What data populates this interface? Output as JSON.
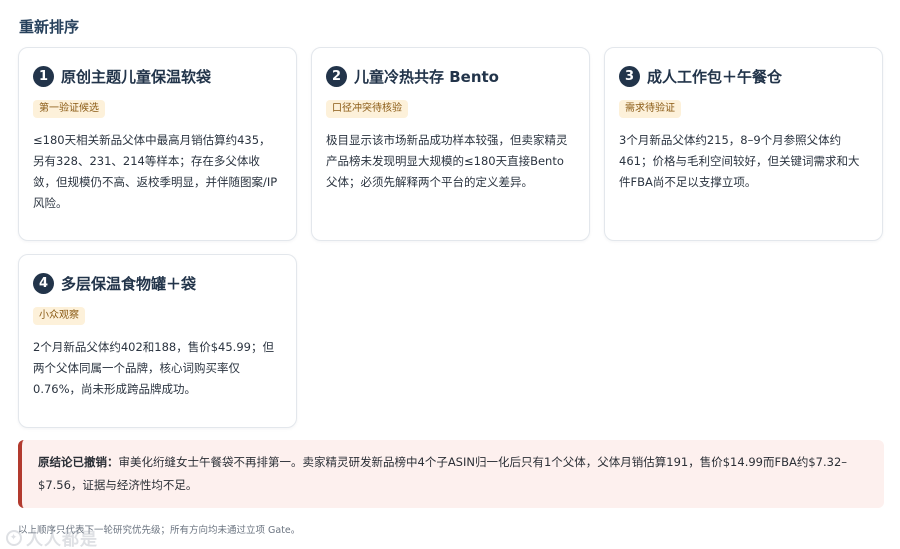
{
  "page": {
    "title": "重新排序"
  },
  "cards": [
    {
      "number": "1",
      "title": "原创主题儿童保温软袋",
      "tag": "第一验证候选",
      "body": "≤180天相关新品父体中最高月销估算约435，另有328、231、214等样本；存在多父体收敛，但规模仍不高、返校季明显，并伴随图案/IP风险。"
    },
    {
      "number": "2",
      "title": "儿童冷热共存 Bento",
      "tag": "口径冲突待核验",
      "body": "极目显示该市场新品成功样本较强，但卖家精灵产品榜未发现明显大规模的≤180天直接Bento父体；必须先解释两个平台的定义差异。"
    },
    {
      "number": "3",
      "title": "成人工作包＋午餐仓",
      "tag": "需求待验证",
      "body": "3个月新品父体约215，8–9个月参照父体约461；价格与毛利空间较好，但关键词需求和大件FBA尚不足以支撑立项。"
    },
    {
      "number": "4",
      "title": "多层保温食物罐＋袋",
      "tag": "小众观察",
      "body": "2个月新品父体约402和188，售价$45.99；但两个父体同属一个品牌，核心词购买率仅0.76%，尚未形成跨品牌成功。"
    }
  ],
  "alert": {
    "label": "原结论已撤销：",
    "text": "审美化绗缝女士午餐袋不再排第一。卖家精灵研发新品榜中4个子ASIN归一化后只有1个父体，父体月销估算191，售价$14.99而FBA约$7.32–$7.56，证据与经济性均不足。"
  },
  "footnote": "以上顺序只代表下一轮研究优先级；所有方向均未通过立项 Gate。",
  "watermark": "人人都是"
}
